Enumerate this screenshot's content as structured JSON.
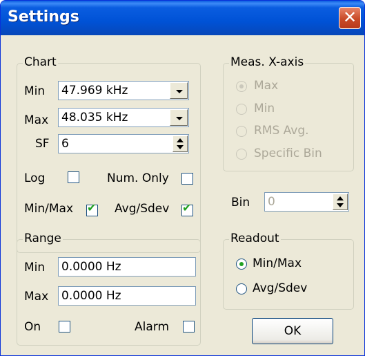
{
  "window": {
    "title": "Settings",
    "close_icon_glyph": "✕"
  },
  "chart_group": {
    "legend": "Chart",
    "min_label": "Min",
    "min_value": "47.969 kHz",
    "max_label": "Max",
    "max_value": "48.035 kHz",
    "sf_label": "SF",
    "sf_value": "6",
    "log_label": "Log",
    "log_checked": false,
    "num_only_label": "Num. Only",
    "num_only_checked": false,
    "minmax_label": "Min/Max",
    "minmax_checked": true,
    "avgsdev_label": "Avg/Sdev",
    "avgsdev_checked": true
  },
  "meas_group": {
    "legend": "Meas. X-axis",
    "options": [
      "Max",
      "Min",
      "RMS Avg.",
      "Specific Bin"
    ],
    "selected": "Max",
    "enabled": false
  },
  "bin": {
    "label": "Bin",
    "value": "0",
    "enabled": false
  },
  "range_group": {
    "legend": "Range",
    "min_label": "Min",
    "min_value": "0.0000 Hz",
    "max_label": "Max",
    "max_value": "0.0000 Hz",
    "on_label": "On",
    "on_checked": false,
    "alarm_label": "Alarm",
    "alarm_checked": false
  },
  "readout_group": {
    "legend": "Readout",
    "options": [
      "Min/Max",
      "Avg/Sdev"
    ],
    "selected": "Min/Max"
  },
  "ok_label": "OK",
  "colors": {
    "title_bar": "#0052d6",
    "dialog_bg": "#ece9d8",
    "check_mark": "#21a121"
  }
}
